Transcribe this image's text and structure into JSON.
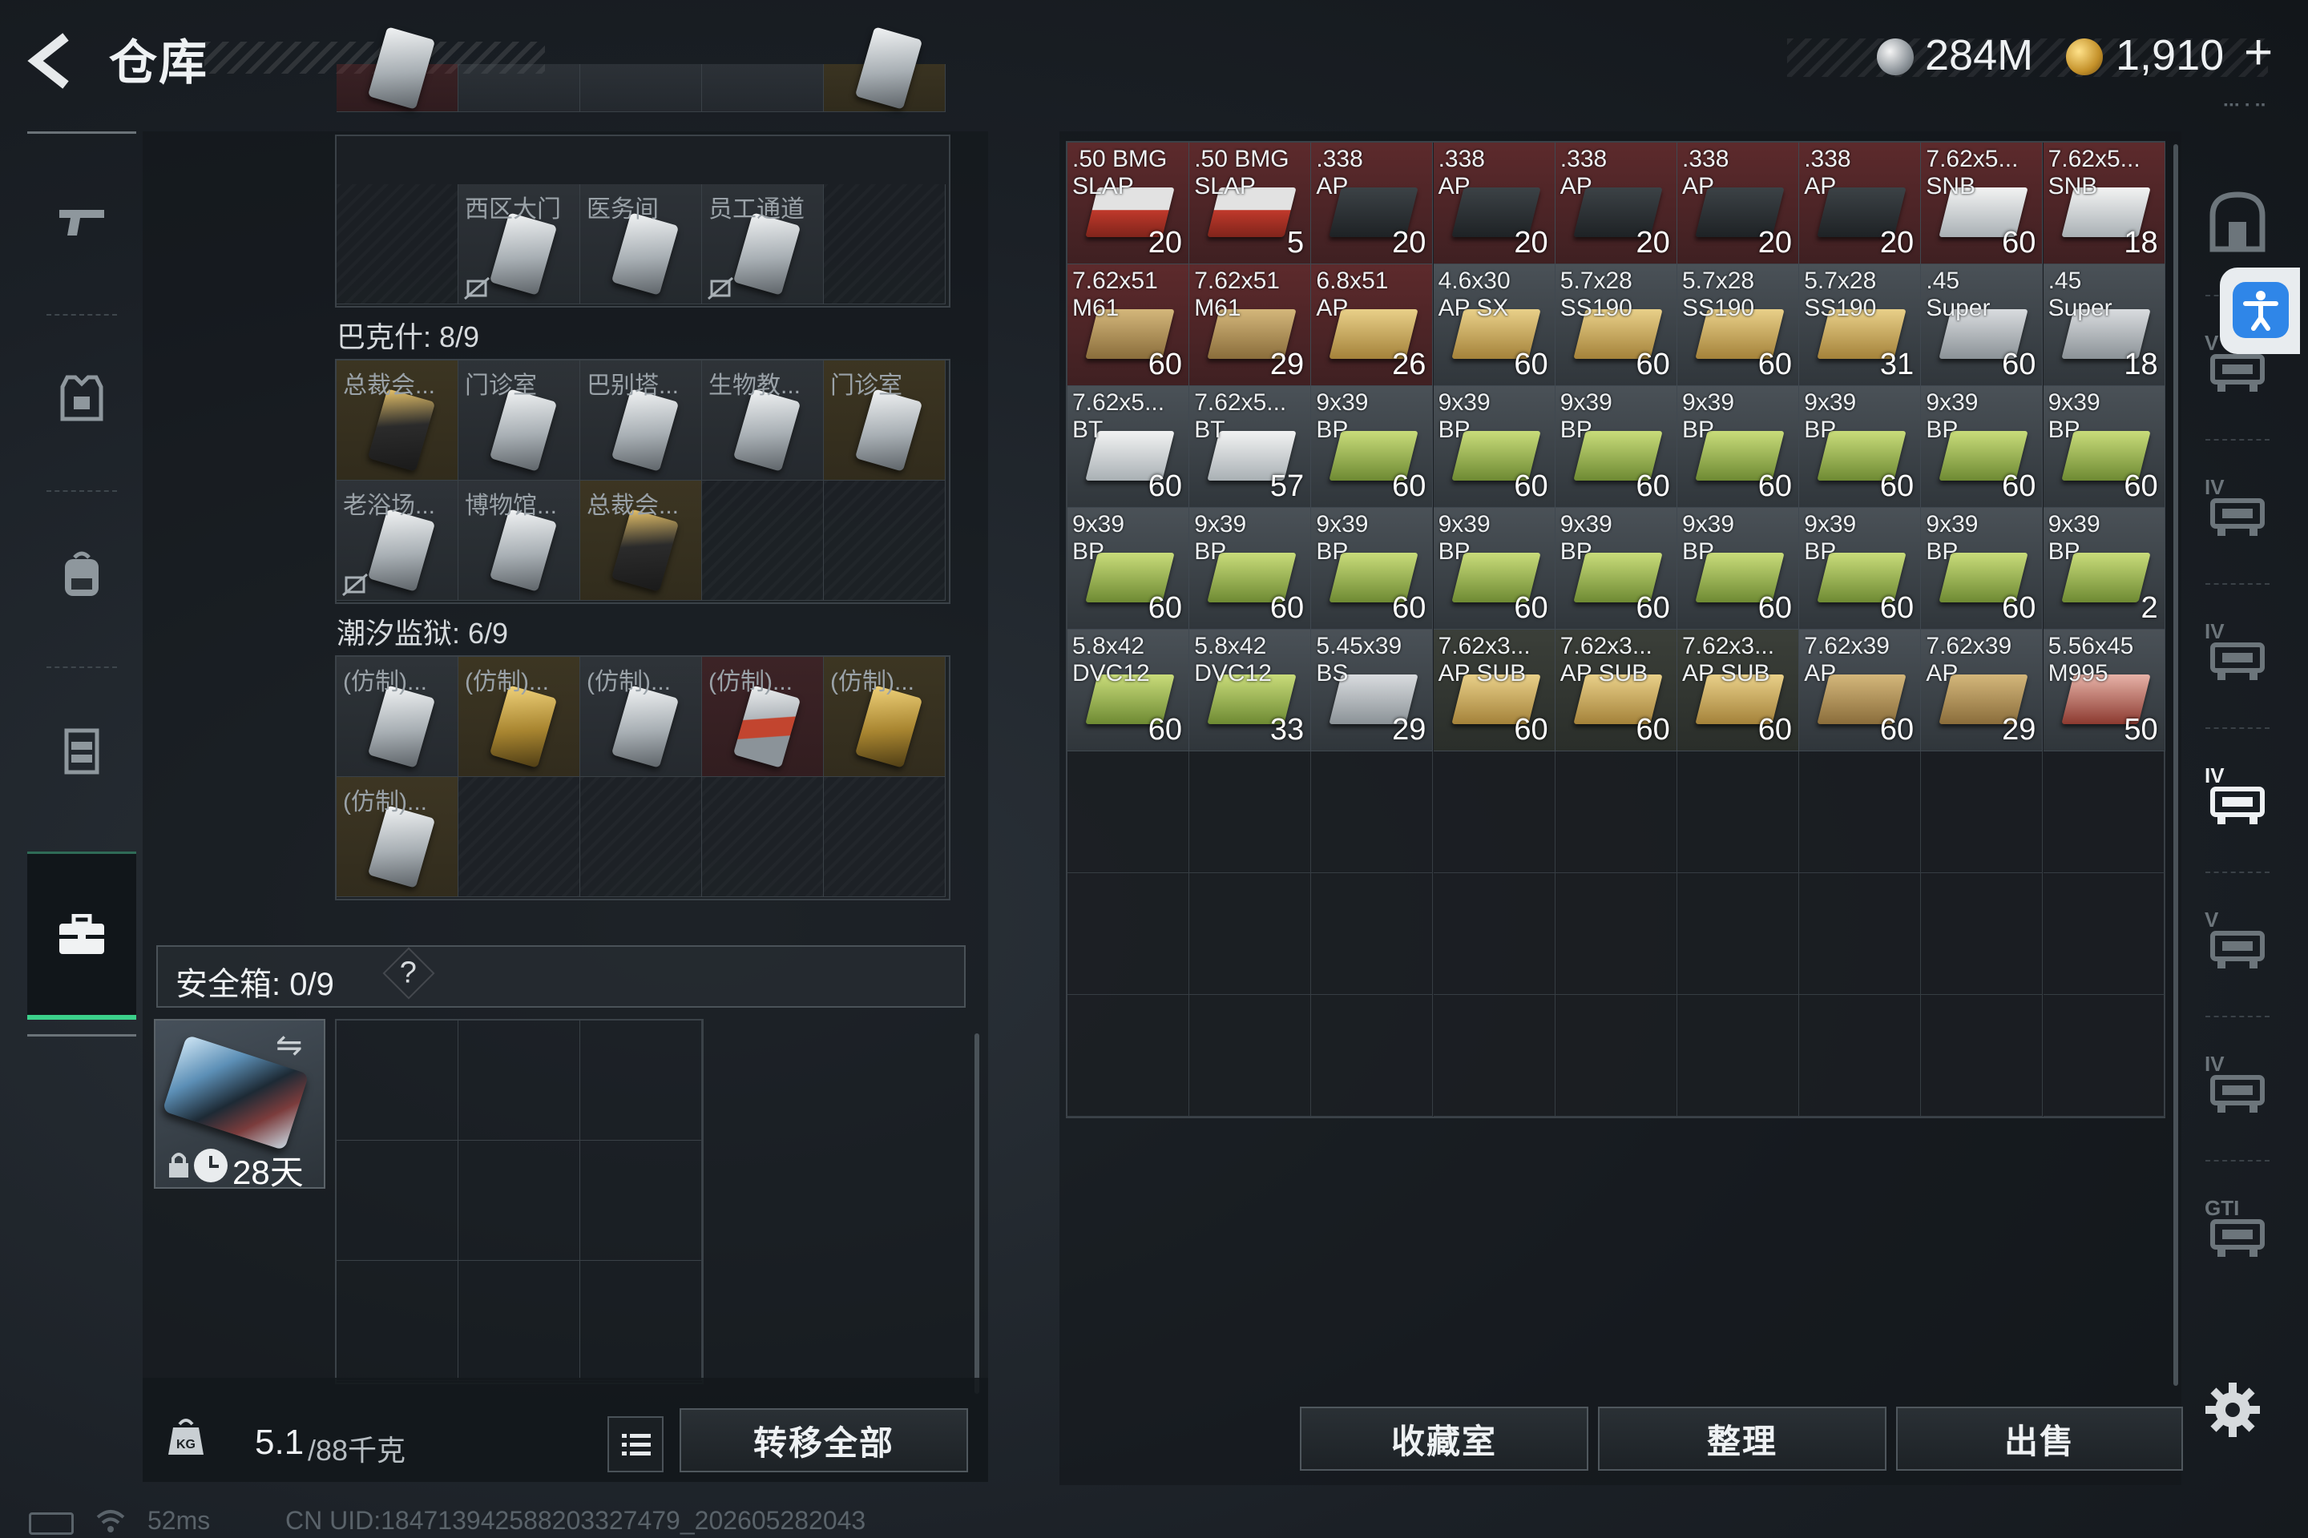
{
  "header": {
    "title": "仓库",
    "currency": [
      {
        "name": "silver-coin",
        "amount": "284M"
      },
      {
        "name": "gold-coin",
        "amount": "1,910"
      }
    ],
    "plus": "+",
    "version_hint": "▪▪▪ ▪ ▪▪"
  },
  "left_nav": {
    "items": [
      {
        "name": "weapons",
        "icon": "gun-icon"
      },
      {
        "name": "armor",
        "icon": "vest-icon"
      },
      {
        "name": "backpack",
        "icon": "backpack-icon"
      },
      {
        "name": "chest-rig",
        "icon": "rig-icon"
      },
      {
        "name": "pouch",
        "icon": "toolbox-icon",
        "selected": true
      }
    ]
  },
  "containers": [
    {
      "label": "",
      "keys": [
        {
          "label": "",
          "color": "red",
          "card": "silver"
        },
        {
          "label": "",
          "color": "gray",
          "card": "none"
        },
        {
          "label": "",
          "color": "gray",
          "card": "none"
        },
        {
          "label": "",
          "color": "gray",
          "card": "none"
        },
        {
          "label": "",
          "color": "yellow",
          "card": "silver"
        },
        {
          "label": "",
          "color": "empty",
          "card": "none"
        },
        {
          "label": "西区大门",
          "color": "gray",
          "card": "silver",
          "locked": true
        },
        {
          "label": "医务间",
          "color": "gray",
          "card": "silver"
        },
        {
          "label": "员工通道",
          "color": "gray",
          "card": "silver",
          "locked": true
        },
        {
          "label": "",
          "color": "empty",
          "card": "none"
        }
      ]
    },
    {
      "label": "巴克什: 8/9",
      "keys": [
        {
          "label": "总裁会...",
          "color": "yellow",
          "card": "dark"
        },
        {
          "label": "门诊室",
          "color": "gray",
          "card": "silver"
        },
        {
          "label": "巴别塔...",
          "color": "gray",
          "card": "silver"
        },
        {
          "label": "生物教...",
          "color": "gray",
          "card": "silver"
        },
        {
          "label": "门诊室",
          "color": "yellow",
          "card": "silver"
        },
        {
          "label": "老浴场...",
          "color": "gray",
          "card": "silver",
          "locked": true
        },
        {
          "label": "博物馆...",
          "color": "gray",
          "card": "silver"
        },
        {
          "label": "总裁会...",
          "color": "yellow",
          "card": "dark"
        },
        {
          "label": "",
          "color": "empty",
          "card": "none"
        },
        {
          "label": "",
          "color": "empty",
          "card": "none"
        }
      ]
    },
    {
      "label": "潮汐监狱: 6/9",
      "keys": [
        {
          "label": "(仿制)...",
          "color": "gray",
          "card": "silver"
        },
        {
          "label": "(仿制)...",
          "color": "yellow",
          "card": "gold"
        },
        {
          "label": "(仿制)...",
          "color": "gray",
          "card": "silver"
        },
        {
          "label": "(仿制)...",
          "color": "red",
          "card": "redc"
        },
        {
          "label": "(仿制)...",
          "color": "yellow",
          "card": "gold"
        },
        {
          "label": "(仿制)...",
          "color": "yellow",
          "card": "silver"
        },
        {
          "label": "",
          "color": "empty",
          "card": "none"
        },
        {
          "label": "",
          "color": "empty",
          "card": "none"
        },
        {
          "label": "",
          "color": "empty",
          "card": "none"
        },
        {
          "label": "",
          "color": "empty",
          "card": "none"
        }
      ]
    }
  ],
  "safe_box": {
    "title": "安全箱: 0/9",
    "help": "?",
    "days": "28天"
  },
  "weight": {
    "current": "5.1",
    "max": "/88千克"
  },
  "transfer_all_label": "转移全部",
  "status": {
    "ping": "52ms",
    "uid": "CN UID:184713942588203327479_202605282043"
  },
  "stash": {
    "items": [
      {
        "name": ".50 BMG\nSLAP",
        "count": "20",
        "bg": "red",
        "box": "box-red"
      },
      {
        "name": ".50 BMG\nSLAP",
        "count": "5",
        "bg": "red",
        "box": "box-red"
      },
      {
        "name": ".338\nAP",
        "count": "20",
        "bg": "red",
        "box": "box-dark"
      },
      {
        "name": ".338\nAP",
        "count": "20",
        "bg": "red",
        "box": "box-dark"
      },
      {
        "name": ".338\nAP",
        "count": "20",
        "bg": "red",
        "box": "box-dark"
      },
      {
        "name": ".338\nAP",
        "count": "20",
        "bg": "red",
        "box": "box-dark"
      },
      {
        "name": ".338\nAP",
        "count": "20",
        "bg": "red",
        "box": "box-dark"
      },
      {
        "name": "7.62x5...\nSNB",
        "count": "60",
        "bg": "red",
        "box": "box-white"
      },
      {
        "name": "7.62x5...\nSNB",
        "count": "18",
        "bg": "red",
        "box": "box-white"
      },
      {
        "name": "7.62x51\nM61",
        "count": "60",
        "bg": "red",
        "box": "box-tan"
      },
      {
        "name": "7.62x51\nM61",
        "count": "29",
        "bg": "red",
        "box": "box-tan"
      },
      {
        "name": "6.8x51\nAP",
        "count": "26",
        "bg": "red",
        "box": "box-gold"
      },
      {
        "name": "4.6x30\nAP SX",
        "count": "60",
        "bg": "gray",
        "box": "box-gold"
      },
      {
        "name": "5.7x28\nSS190",
        "count": "60",
        "bg": "gray",
        "box": "box-gold"
      },
      {
        "name": "5.7x28\nSS190",
        "count": "60",
        "bg": "gray",
        "box": "box-gold"
      },
      {
        "name": "5.7x28\nSS190",
        "count": "31",
        "bg": "gray",
        "box": "box-gold"
      },
      {
        "name": ".45\nSuper",
        "count": "60",
        "bg": "gray",
        "box": "box-silver"
      },
      {
        "name": ".45\nSuper",
        "count": "18",
        "bg": "gray",
        "box": "box-silver"
      },
      {
        "name": "7.62x5...\nBT",
        "count": "60",
        "bg": "gray",
        "box": "box-white"
      },
      {
        "name": "7.62x5...\nBT",
        "count": "57",
        "bg": "gray",
        "box": "box-white"
      },
      {
        "name": "9x39\nBP",
        "count": "60",
        "bg": "gray",
        "box": "box-green"
      },
      {
        "name": "9x39\nBP",
        "count": "60",
        "bg": "gray",
        "box": "box-green"
      },
      {
        "name": "9x39\nBP",
        "count": "60",
        "bg": "gray",
        "box": "box-green"
      },
      {
        "name": "9x39\nBP",
        "count": "60",
        "bg": "gray",
        "box": "box-green"
      },
      {
        "name": "9x39\nBP",
        "count": "60",
        "bg": "gray",
        "box": "box-green"
      },
      {
        "name": "9x39\nBP",
        "count": "60",
        "bg": "gray",
        "box": "box-green"
      },
      {
        "name": "9x39\nBP",
        "count": "60",
        "bg": "gray",
        "box": "box-green"
      },
      {
        "name": "9x39\nBP",
        "count": "60",
        "bg": "gray",
        "box": "box-green"
      },
      {
        "name": "9x39\nBP",
        "count": "60",
        "bg": "gray",
        "box": "box-green"
      },
      {
        "name": "9x39\nBP",
        "count": "60",
        "bg": "gray",
        "box": "box-green"
      },
      {
        "name": "9x39\nBP",
        "count": "60",
        "bg": "gray",
        "box": "box-green"
      },
      {
        "name": "9x39\nBP",
        "count": "60",
        "bg": "gray",
        "box": "box-green"
      },
      {
        "name": "9x39\nBP",
        "count": "60",
        "bg": "gray",
        "box": "box-green"
      },
      {
        "name": "9x39\nBP",
        "count": "60",
        "bg": "gray",
        "box": "box-green"
      },
      {
        "name": "9x39\nBP",
        "count": "60",
        "bg": "gray",
        "box": "box-green"
      },
      {
        "name": "9x39\nBP",
        "count": "2",
        "bg": "gray",
        "box": "box-green"
      },
      {
        "name": "5.8x42\nDVC12",
        "count": "60",
        "bg": "gray",
        "box": "box-green"
      },
      {
        "name": "5.8x42\nDVC12",
        "count": "33",
        "bg": "gray",
        "box": "box-green"
      },
      {
        "name": "5.45x39\nBS",
        "count": "29",
        "bg": "gray",
        "box": "box-silver"
      },
      {
        "name": "7.62x3...\nAP SUB",
        "count": "60",
        "bg": "dark",
        "box": "box-gold"
      },
      {
        "name": "7.62x3...\nAP SUB",
        "count": "60",
        "bg": "dark",
        "box": "box-gold"
      },
      {
        "name": "7.62x3...\nAP SUB",
        "count": "60",
        "bg": "dark",
        "box": "box-gold"
      },
      {
        "name": "7.62x39\nAP",
        "count": "60",
        "bg": "gray",
        "box": "box-tan"
      },
      {
        "name": "7.62x39\nAP",
        "count": "29",
        "bg": "gray",
        "box": "box-tan"
      },
      {
        "name": "5.56x45\nM995",
        "count": "50",
        "bg": "gray",
        "box": "box-pinkred"
      }
    ]
  },
  "categories": [
    {
      "name": "all-items",
      "icon": "bag-icon"
    },
    {
      "name": "cat-v-weapons",
      "icon": "weapon-case-icon"
    },
    {
      "name": "cat-iv-ammo",
      "icon": "ammo-case-icon"
    },
    {
      "name": "cat-iv-parts",
      "icon": "parts-case-icon"
    },
    {
      "name": "cat-iv-keys",
      "icon": "key-case-icon",
      "selected": true
    },
    {
      "name": "cat-v-misc",
      "icon": "misc-case-icon"
    },
    {
      "name": "cat-iv-medical",
      "icon": "med-case-icon"
    },
    {
      "name": "cat-gti",
      "icon": "gti-case-icon"
    }
  ],
  "category_marks": [
    "V",
    "IV",
    "IV",
    "IV",
    "V",
    "IV",
    "GTI"
  ],
  "actions": {
    "collection": "收藏室",
    "organize": "整理",
    "sell": "出售"
  }
}
